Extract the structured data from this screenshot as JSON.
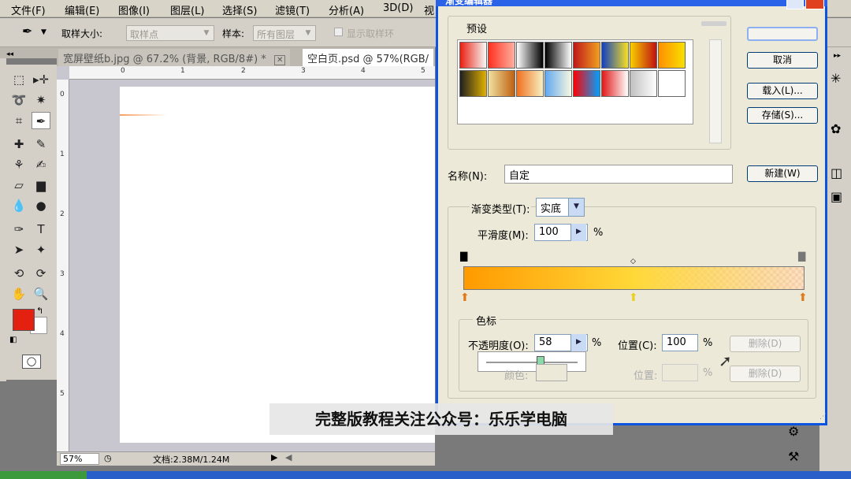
{
  "menu": [
    "文件(F)",
    "编辑(E)",
    "图像(I)",
    "图层(L)",
    "选择(S)",
    "滤镜(T)",
    "分析(A)",
    "3D(D)",
    "视"
  ],
  "options": {
    "sample_size_label": "取样大小:",
    "sample_size_value": "取样点",
    "sample_label": "样本:",
    "sample_value": "所有图层",
    "show_ring_label": "显示取样环"
  },
  "tabs": [
    {
      "label": "宽屏壁纸b.jpg @ 67.2% (背景, RGB/8#) *"
    },
    {
      "label": "空白页.psd @ 57%(RGB/"
    }
  ],
  "ruler_h": [
    "0",
    "1",
    "2",
    "3",
    "4",
    "5"
  ],
  "ruler_v": [
    "0",
    "1",
    "2",
    "3",
    "4",
    "5"
  ],
  "status": {
    "zoom": "57%",
    "doc": "文档:2.38M/1.24M"
  },
  "colors": {
    "foreground": "#e42010",
    "background": "#ffffff",
    "dialog_border": "#0a54e0"
  },
  "dialog": {
    "title": "渐变编辑器",
    "presets_label": "预设",
    "buttons": {
      "ok": "",
      "cancel": "取消",
      "load": "载入(L)...",
      "save": "存储(S)...",
      "new": "新建(W)"
    },
    "name_label": "名称(N):",
    "name_value": "自定",
    "type_label": "渐变类型(T):",
    "type_value": "实底",
    "smooth_label": "平滑度(M):",
    "smooth_value": "100",
    "percent": "%",
    "stops_group": "色标",
    "opacity_label": "不透明度(O):",
    "opacity_value": "58",
    "position_label": "位置(C):",
    "position_value": "100",
    "delete_label": "删除(D)",
    "color_label": "颜色:",
    "position2_label": "位置:",
    "delete2_label": "删除(D)"
  },
  "subtitle": "完整版教程关注公众号：乐乐学电脑",
  "swatches": [
    [
      "#e82010",
      "#f8f8f8"
    ],
    [
      "#ff3020",
      "#ffb0a0"
    ],
    [
      "#ffffff",
      "#000000"
    ],
    [
      "#000000",
      "#ffffff"
    ],
    [
      "#c01818",
      "#f0a020"
    ],
    [
      "#1040c0",
      "#f8e020"
    ],
    [
      "#f8d000",
      "#c01010"
    ],
    [
      "#ff9000",
      "#f8e000"
    ],
    [
      "#202020",
      "#e0b000"
    ],
    [
      "#f0e0a0",
      "#c06010"
    ],
    [
      "#f07020",
      "#f8f0c0"
    ],
    [
      "#60a8f0",
      "#f8f8e0"
    ],
    [
      "#ff0000",
      "#00a0ff"
    ],
    [
      "#e01818",
      "#ffffff"
    ],
    [
      "#c0c0c0",
      "#ffffff"
    ],
    [
      "#ffffff",
      "#ffffff"
    ]
  ]
}
